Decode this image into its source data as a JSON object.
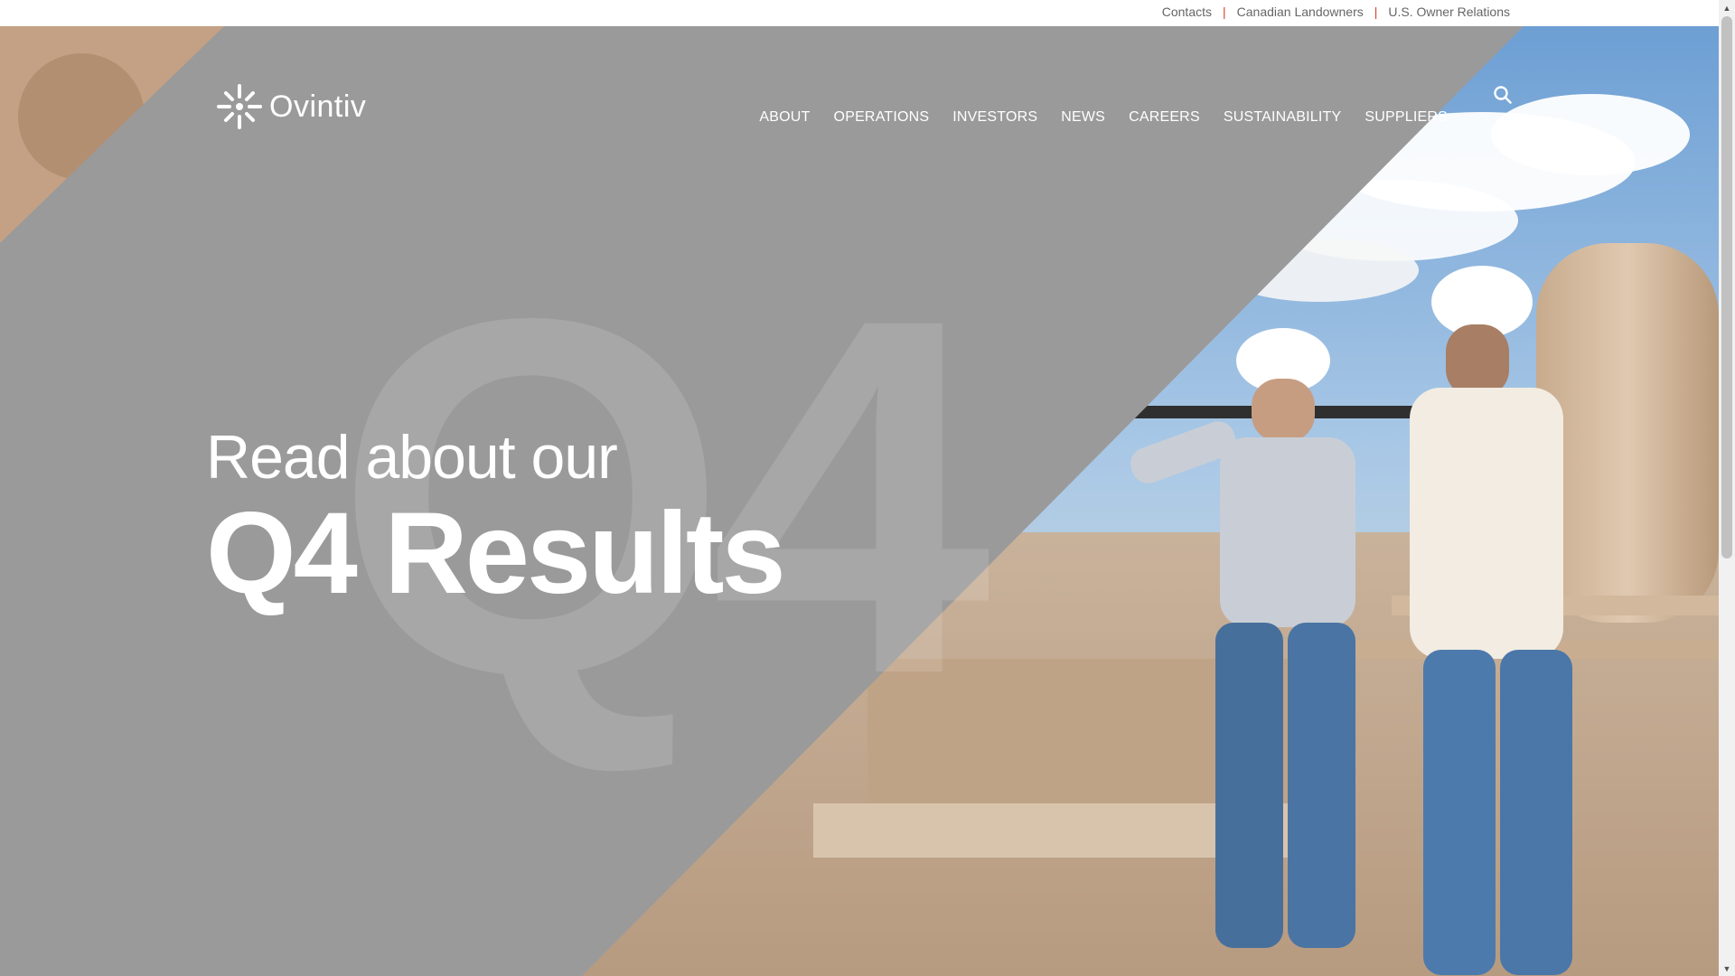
{
  "utility_nav": {
    "links": [
      {
        "label": "Contacts"
      },
      {
        "label": "Canadian Landowners"
      },
      {
        "label": "U.S. Owner Relations"
      }
    ],
    "separator": "|"
  },
  "header": {
    "logo_text": "Ovintiv",
    "nav": [
      {
        "label": "ABOUT"
      },
      {
        "label": "OPERATIONS"
      },
      {
        "label": "INVESTORS"
      },
      {
        "label": "NEWS"
      },
      {
        "label": "CAREERS"
      },
      {
        "label": "SUSTAINABILITY"
      },
      {
        "label": "SUPPLIERS"
      }
    ],
    "search_icon": "search-icon"
  },
  "hero": {
    "subheading": "Read about our",
    "heading": "Q4 Results",
    "watermark": "Q4"
  },
  "colors": {
    "accent": "#d3492b",
    "hero_grey": "#9a9a9a"
  }
}
